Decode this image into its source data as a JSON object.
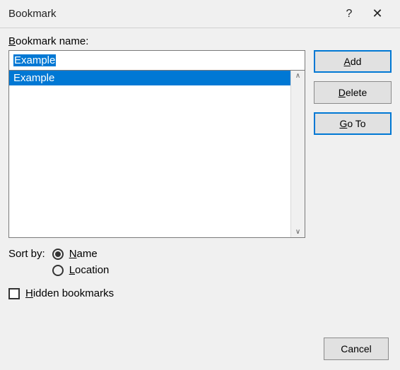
{
  "titlebar": {
    "title": "Bookmark",
    "help_label": "?"
  },
  "main": {
    "name_label_pre": "B",
    "name_label_post": "ookmark name:",
    "input_value": "Example",
    "list_items": [
      "Example"
    ]
  },
  "buttons": {
    "add_pre": "A",
    "add_post": "dd",
    "delete_pre": "D",
    "delete_post": "elete",
    "goto_pre": "G",
    "goto_post": "o To",
    "cancel": "Cancel"
  },
  "sort": {
    "label": "Sort by:",
    "name_pre": "N",
    "name_post": "ame",
    "location_pre": "L",
    "location_post": "ocation",
    "selected": "name"
  },
  "checkbox": {
    "hidden_pre": "H",
    "hidden_post": "idden bookmarks",
    "checked": false
  }
}
